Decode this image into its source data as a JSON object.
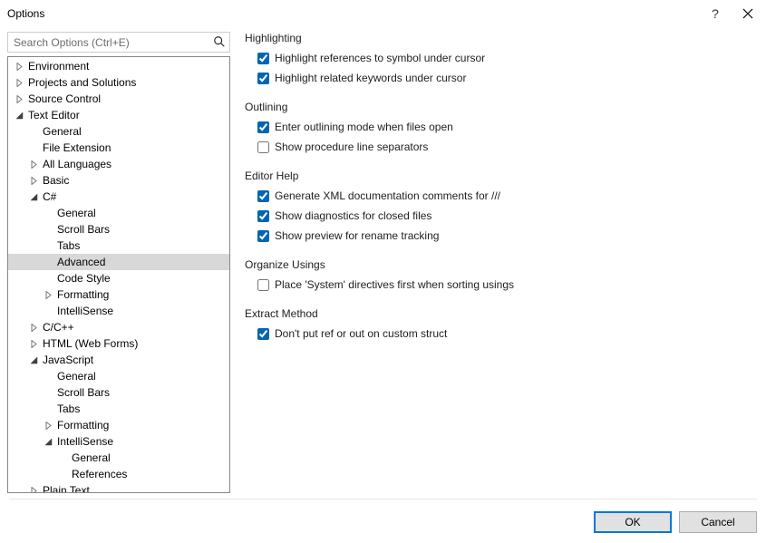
{
  "window": {
    "title": "Options"
  },
  "titlebar": {
    "help": "?",
    "close": "×"
  },
  "search": {
    "placeholder": "Search Options (Ctrl+E)"
  },
  "tree": {
    "items": [
      {
        "label": "Environment",
        "depth": 0,
        "state": "collapsed"
      },
      {
        "label": "Projects and Solutions",
        "depth": 0,
        "state": "collapsed"
      },
      {
        "label": "Source Control",
        "depth": 0,
        "state": "collapsed"
      },
      {
        "label": "Text Editor",
        "depth": 0,
        "state": "expanded"
      },
      {
        "label": "General",
        "depth": 1,
        "state": "leaf"
      },
      {
        "label": "File Extension",
        "depth": 1,
        "state": "leaf"
      },
      {
        "label": "All Languages",
        "depth": 1,
        "state": "collapsed"
      },
      {
        "label": "Basic",
        "depth": 1,
        "state": "collapsed"
      },
      {
        "label": "C#",
        "depth": 1,
        "state": "expanded"
      },
      {
        "label": "General",
        "depth": 2,
        "state": "leaf"
      },
      {
        "label": "Scroll Bars",
        "depth": 2,
        "state": "leaf"
      },
      {
        "label": "Tabs",
        "depth": 2,
        "state": "leaf"
      },
      {
        "label": "Advanced",
        "depth": 2,
        "state": "leaf",
        "selected": true
      },
      {
        "label": "Code Style",
        "depth": 2,
        "state": "leaf"
      },
      {
        "label": "Formatting",
        "depth": 2,
        "state": "collapsed"
      },
      {
        "label": "IntelliSense",
        "depth": 2,
        "state": "leaf"
      },
      {
        "label": "C/C++",
        "depth": 1,
        "state": "collapsed"
      },
      {
        "label": "HTML (Web Forms)",
        "depth": 1,
        "state": "collapsed"
      },
      {
        "label": "JavaScript",
        "depth": 1,
        "state": "expanded"
      },
      {
        "label": "General",
        "depth": 2,
        "state": "leaf"
      },
      {
        "label": "Scroll Bars",
        "depth": 2,
        "state": "leaf"
      },
      {
        "label": "Tabs",
        "depth": 2,
        "state": "leaf"
      },
      {
        "label": "Formatting",
        "depth": 2,
        "state": "collapsed"
      },
      {
        "label": "IntelliSense",
        "depth": 2,
        "state": "expanded"
      },
      {
        "label": "General",
        "depth": 3,
        "state": "leaf"
      },
      {
        "label": "References",
        "depth": 3,
        "state": "leaf"
      },
      {
        "label": "Plain Text",
        "depth": 1,
        "state": "collapsed"
      }
    ]
  },
  "options": {
    "groups": [
      {
        "title": "Highlighting",
        "items": [
          {
            "label": "Highlight references to symbol under cursor",
            "checked": true
          },
          {
            "label": "Highlight related keywords under cursor",
            "checked": true
          }
        ]
      },
      {
        "title": "Outlining",
        "items": [
          {
            "label": "Enter outlining mode when files open",
            "checked": true
          },
          {
            "label": "Show procedure line separators",
            "checked": false
          }
        ]
      },
      {
        "title": "Editor Help",
        "items": [
          {
            "label": "Generate XML documentation comments for ///",
            "checked": true
          },
          {
            "label": "Show diagnostics for closed files",
            "checked": true
          },
          {
            "label": "Show preview for rename tracking",
            "checked": true
          }
        ]
      },
      {
        "title": "Organize Usings",
        "items": [
          {
            "label": "Place 'System' directives first when sorting usings",
            "checked": false
          }
        ]
      },
      {
        "title": "Extract Method",
        "items": [
          {
            "label": "Don't put ref or out on custom struct",
            "checked": true
          }
        ]
      }
    ]
  },
  "buttons": {
    "ok": "OK",
    "cancel": "Cancel"
  }
}
